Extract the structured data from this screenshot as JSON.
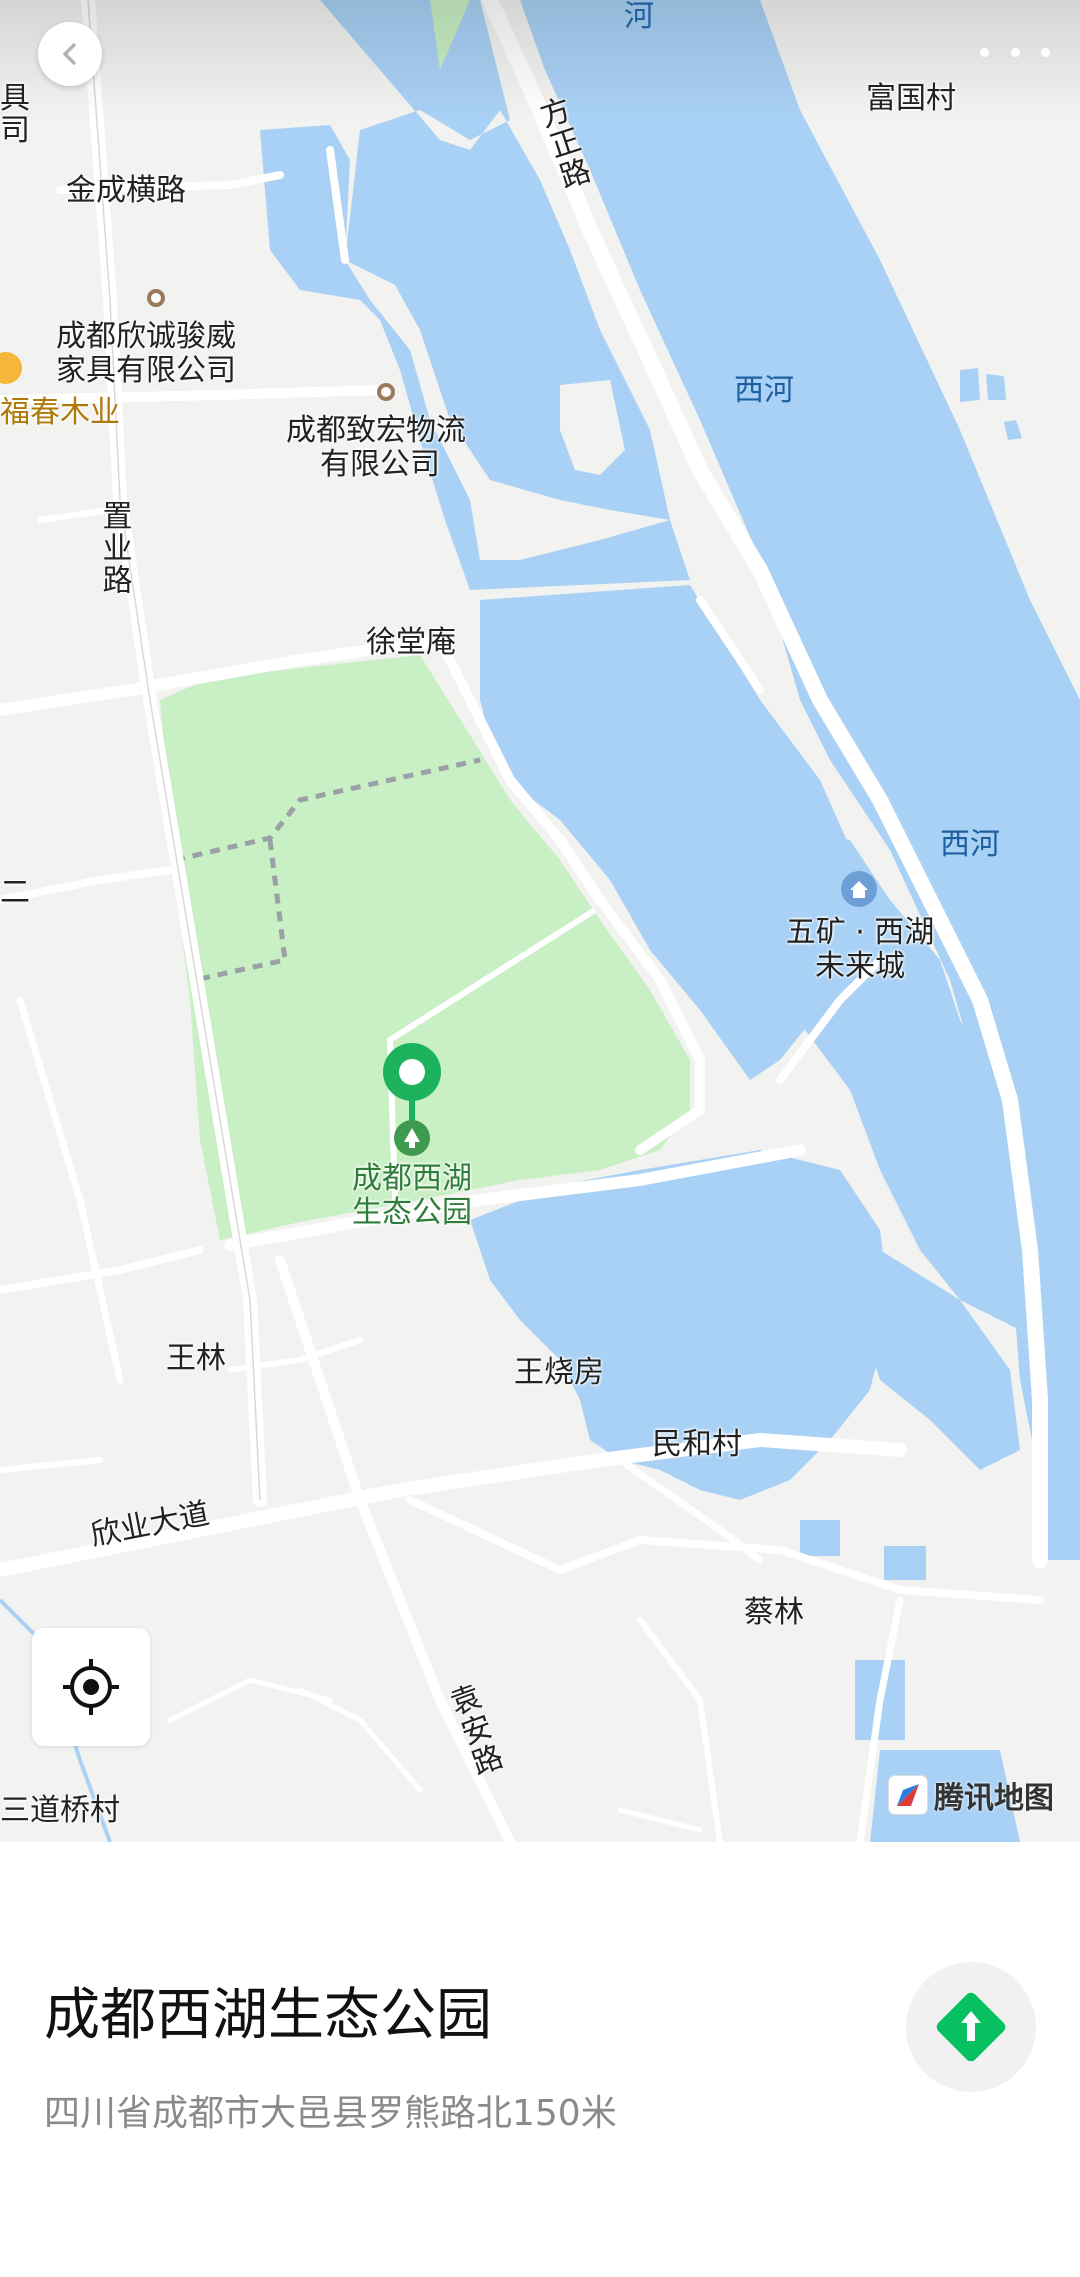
{
  "map": {
    "labels": {
      "jincheng_heng_road": "金成横路",
      "xincheng_company_l1": "成都欣诚骏威",
      "xincheng_company_l2": "家具有限公司",
      "fuchun_muye": "福春木业",
      "zhihong_l1": "成都致宏物流",
      "zhihong_l2": "有限公司",
      "zhiye_road": "置业路",
      "fangzheng_road": "方正路",
      "river_top": "河",
      "fuguo_village": "富国村",
      "xihe_1": "西河",
      "xihe_2": "西河",
      "xutang_an": "徐堂庵",
      "wukuang_l1": "五矿 · 西湖",
      "wukuang_l2": "未来城",
      "park_l1": "成都西湖",
      "park_l2": "生态公园",
      "wanglin": "王林",
      "wangshaofang": "王烧房",
      "minhe_village": "民和村",
      "xinye_avenue": "欣业大道",
      "cailin": "蔡林",
      "yuan_an_road": "袁安路",
      "sandaoqiao_village": "三道桥村",
      "left_edge_top_1": "具",
      "left_edge_top_2": "司",
      "left_edge_mid": "二"
    },
    "logo_text": "腾讯地图",
    "colors": {
      "water": "#a9d1f5",
      "park": "#c9efc4",
      "land": "#f2f2f0",
      "road": "#ffffff",
      "pin": "#1db35c",
      "nav": "#07c160"
    }
  },
  "controls": {
    "back_icon": "chevron-left-icon",
    "more_icon": "more-dots-icon",
    "locate_icon": "locate-crosshair-icon"
  },
  "place": {
    "name": "成都西湖生态公园",
    "address": "四川省成都市大邑县罗熊路北150米",
    "nav_icon": "navigate-arrow-icon"
  }
}
